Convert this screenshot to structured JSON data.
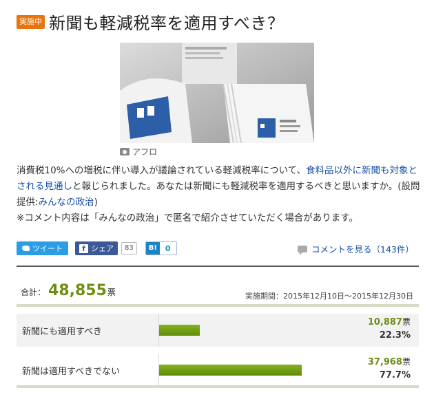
{
  "header": {
    "badge": "実施中",
    "title": "新聞も軽減税率を適用すべき？"
  },
  "photo": {
    "credit": "アフロ"
  },
  "description": {
    "part1": "消費税10%への増税に伴い導入が議論されている軽減税率について、",
    "link1": "食料品以外に新聞も対象とされる見通し",
    "part2": "と報じられました。あなたは新聞にも軽減税率を適用するべきと思いますか。(設問提供:",
    "link2": "みんなの政治",
    "part3": ")",
    "note": "※コメント内容は「みんなの政治」で匿名で紹介させていただく場合があります。"
  },
  "share": {
    "tweet_label": "ツイート",
    "facebook_label": "シェア",
    "facebook_count": "83",
    "hatena_label": "B!",
    "hatena_count": "0",
    "comments_label": "コメントを見る（143件）"
  },
  "summary": {
    "total_label": "合計：",
    "total_votes": "48,855",
    "total_unit": "票",
    "period": "実施期間：2015年12月10日〜2015年12月30日"
  },
  "chart_data": {
    "type": "bar",
    "categories": [
      "新聞にも適用すべき",
      "新聞は適用すべきでない"
    ],
    "values": [
      10887,
      37968
    ],
    "percent": [
      22.3,
      77.7
    ],
    "vote_labels": [
      "10,887",
      "37,968"
    ],
    "percent_labels": [
      "22.3%",
      "77.7%"
    ],
    "vote_unit": "票"
  },
  "colors": {
    "accent": "#6e8e12",
    "badge": "#e8740e",
    "link": "#1a4fa8"
  }
}
